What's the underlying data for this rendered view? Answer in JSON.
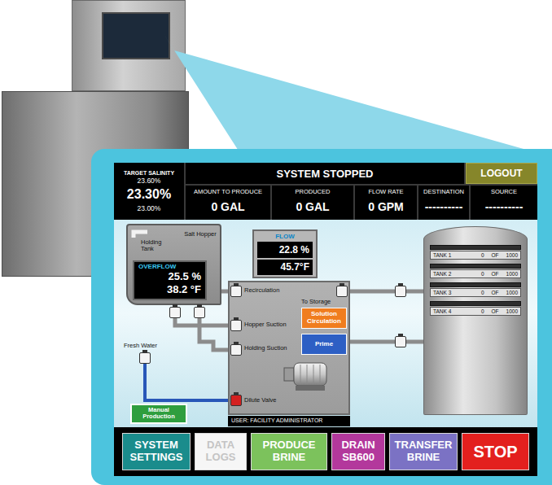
{
  "screen": {
    "target_salinity": {
      "label": "TARGET SALINITY",
      "high": "23.60%",
      "value": "23.30%",
      "low": "23.00%"
    },
    "status": "SYSTEM STOPPED",
    "logout": "LOGOUT",
    "readouts": [
      {
        "label": "AMOUNT TO PRODUCE",
        "value": "0 GAL"
      },
      {
        "label": "PRODUCED",
        "value": "0 GAL"
      },
      {
        "label": "FLOW RATE",
        "value": "0 GPM"
      },
      {
        "label": "DESTINATION",
        "value": "----------"
      },
      {
        "label": "SOURCE",
        "value": "----------"
      }
    ],
    "diagram": {
      "hopper": {
        "title": "Salt Hopper",
        "tank_label": "Holding Tank",
        "overflow": {
          "label": "OVERFLOW",
          "percent": "25.5 %",
          "temp": "38.2 °F"
        }
      },
      "flow": {
        "label": "FLOW",
        "percent": "22.8 %",
        "temp": "45.7°F"
      },
      "fresh_water": "Fresh Water",
      "manual_button": "Manual Production",
      "pump_labels": [
        "Recirculation",
        "To Storage",
        "Hopper Suction",
        "Holding Suction",
        "Dilute Valve"
      ],
      "actions": [
        {
          "label": "Solution Circulation",
          "color": "#f07d1f"
        },
        {
          "label": "Prime",
          "color": "#2d5fc4"
        }
      ],
      "valves": [
        {
          "color": "#f4f4f4"
        },
        {
          "color": "#f4f4f4"
        },
        {
          "color": "#f4f4f4"
        },
        {
          "color": "#f4f4f4"
        },
        {
          "color": "#f4f4f4"
        },
        {
          "color": "#f4f4f4"
        },
        {
          "color": "#f4f4f4"
        },
        {
          "color": "#d42020"
        },
        {
          "color": "#f4f4f4"
        },
        {
          "color": "#f4f4f4"
        }
      ],
      "user": "USER: FACILITY ADMINISTRATOR",
      "tanks": [
        {
          "name": "TANK 1",
          "amount": "0",
          "of": "OF",
          "capacity": "1000",
          "level": 0
        },
        {
          "name": "TANK 2",
          "amount": "0",
          "of": "OF",
          "capacity": "1000",
          "level": 0
        },
        {
          "name": "TANK 3",
          "amount": "0",
          "of": "OF",
          "capacity": "1000",
          "level": 0
        },
        {
          "name": "TANK 4",
          "amount": "0",
          "of": "OF",
          "capacity": "1000",
          "level": 0
        }
      ]
    },
    "buttons": [
      {
        "label": "SYSTEM SETTINGS",
        "color": "#1a8c8c",
        "disabled": false,
        "kind": "normal"
      },
      {
        "label": "DATA LOGS",
        "color": "#f6f6f6",
        "disabled": true,
        "kind": "normal"
      },
      {
        "label": "PRODUCE BRINE",
        "color": "#7cc25c",
        "disabled": false,
        "kind": "normal"
      },
      {
        "label": "DRAIN SB600",
        "color": "#b3389c",
        "disabled": false,
        "kind": "normal"
      },
      {
        "label": "TRANSFER BRINE",
        "color": "#7b72c4",
        "disabled": false,
        "kind": "normal"
      },
      {
        "label": "STOP",
        "color": "#e3201e",
        "disabled": false,
        "kind": "stop"
      }
    ]
  }
}
